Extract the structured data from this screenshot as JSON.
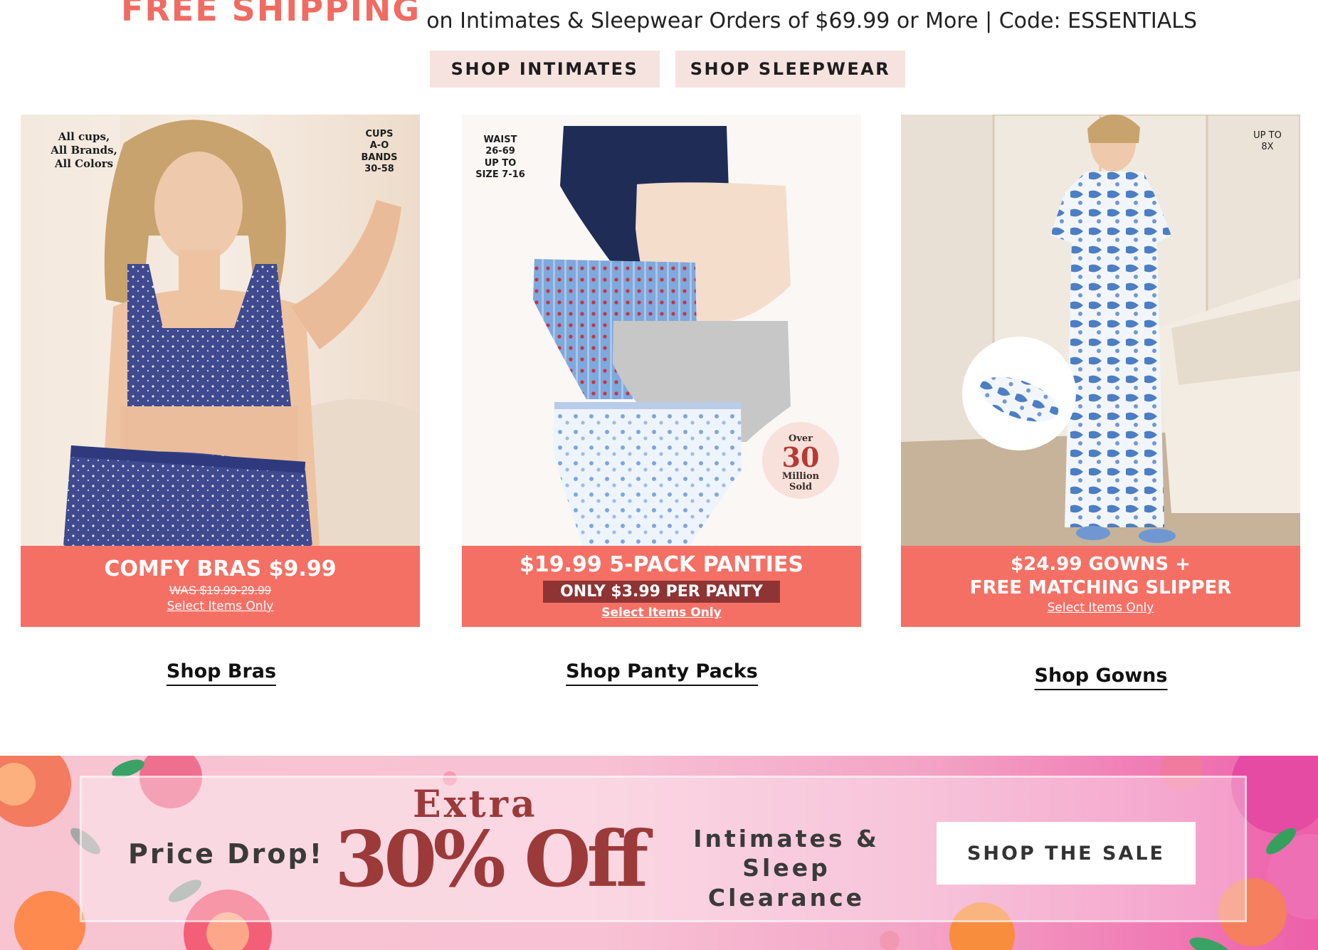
{
  "promo": {
    "free_shipping": "FREE SHIPPING",
    "details": "on Intimates & Sleepwear Orders of $69.99 or More | Code: ESSENTIALS"
  },
  "nav_buttons": {
    "intimates": "SHOP INTIMATES",
    "sleepwear": "SHOP SLEEPWEAR"
  },
  "cards": [
    {
      "corner_left": "All cups,\nAll Brands,\nAll Colors",
      "corner_right": "CUPS\nA-O\nBANDS\n30-58",
      "headline": "COMFY BRAS $9.99",
      "was": "WAS $19.99-29.99",
      "select": "Select Items Only",
      "link": "Shop Bras"
    },
    {
      "corner_left": "WAIST\n26-69\nUP TO\nSIZE 7-16",
      "badge_over": "Over",
      "badge_number": "30",
      "badge_million": "Million",
      "badge_sold": "Sold",
      "headline": "$19.99 5-PACK PANTIES",
      "per_panty": "ONLY $3.99 PER PANTY",
      "select": "Select Items Only",
      "link": "Shop Panty Packs"
    },
    {
      "corner_right": "UP TO\n8X",
      "headline_1": "$24.99 GOWNS +",
      "headline_2": "FREE MATCHING SLIPPER",
      "select": "Select Items Only",
      "link": "Shop Gowns"
    }
  ],
  "banner": {
    "price_drop": "Price Drop!",
    "extra": "Extra",
    "percent": "30% Off",
    "clearance_1": "Intimates &",
    "clearance_2": "Sleep Clearance",
    "cta": "SHOP THE SALE"
  },
  "colors": {
    "accent_coral": "#f47065",
    "promo_red": "#f06b62",
    "button_blush": "#f6e3df",
    "banner_text": "#9c3a3a"
  }
}
